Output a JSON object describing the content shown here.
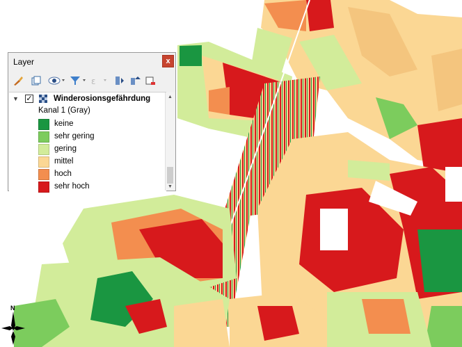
{
  "panel": {
    "title": "Layer",
    "close_symbol": "x"
  },
  "toolbar": {
    "icons": [
      "paintbrush-icon",
      "add-group-icon",
      "eye-icon",
      "filter-icon",
      "filter-expression-icon",
      "expand-all-icon",
      "collapse-all-icon",
      "remove-layer-icon"
    ]
  },
  "layer": {
    "name": "Winderosionsgefährdung",
    "checked": true,
    "band": "Kanal 1 (Gray)",
    "classes": [
      {
        "label": "keine",
        "color": "#1a9641"
      },
      {
        "label": "sehr gering",
        "color": "#7ccc5d"
      },
      {
        "label": "gering",
        "color": "#d2ec9a"
      },
      {
        "label": "mittel",
        "color": "#fbd794"
      },
      {
        "label": "hoch",
        "color": "#f38e4f"
      },
      {
        "label": "sehr hoch",
        "color": "#d7191c"
      }
    ]
  },
  "compass": {
    "north_label": "N"
  }
}
